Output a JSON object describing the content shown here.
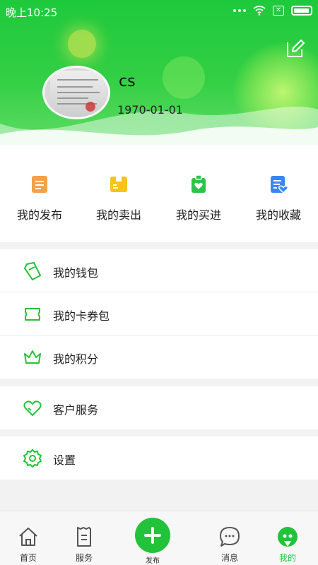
{
  "status_bar": {
    "time": "晚上10:25",
    "sim": "✕"
  },
  "profile": {
    "name": "cs",
    "birthday": "1970-01-01"
  },
  "quick_actions": [
    {
      "label": "我的发布",
      "icon": "publish-list-icon",
      "color": "#f5a04a"
    },
    {
      "label": "我的卖出",
      "icon": "sold-box-icon",
      "color": "#f7c31c"
    },
    {
      "label": "我的买进",
      "icon": "bought-bag-icon",
      "color": "#2fc24a"
    },
    {
      "label": "我的收藏",
      "icon": "favorites-doc-icon",
      "color": "#3b86f0"
    }
  ],
  "menu_group_1": [
    {
      "label": "我的钱包",
      "icon": "wallet-icon"
    },
    {
      "label": "我的卡券包",
      "icon": "coupon-icon"
    },
    {
      "label": "我的积分",
      "icon": "crown-icon"
    }
  ],
  "menu_group_2": [
    {
      "label": "客户服务",
      "icon": "heart-service-icon"
    }
  ],
  "menu_group_3": [
    {
      "label": "设置",
      "icon": "settings-gear-icon"
    }
  ],
  "tabbar": {
    "home": "首页",
    "service": "服务",
    "publish": "发布",
    "messages": "消息",
    "me": "我的"
  },
  "colors": {
    "primary": "#22c33a",
    "header_green": "#1ec93c"
  }
}
